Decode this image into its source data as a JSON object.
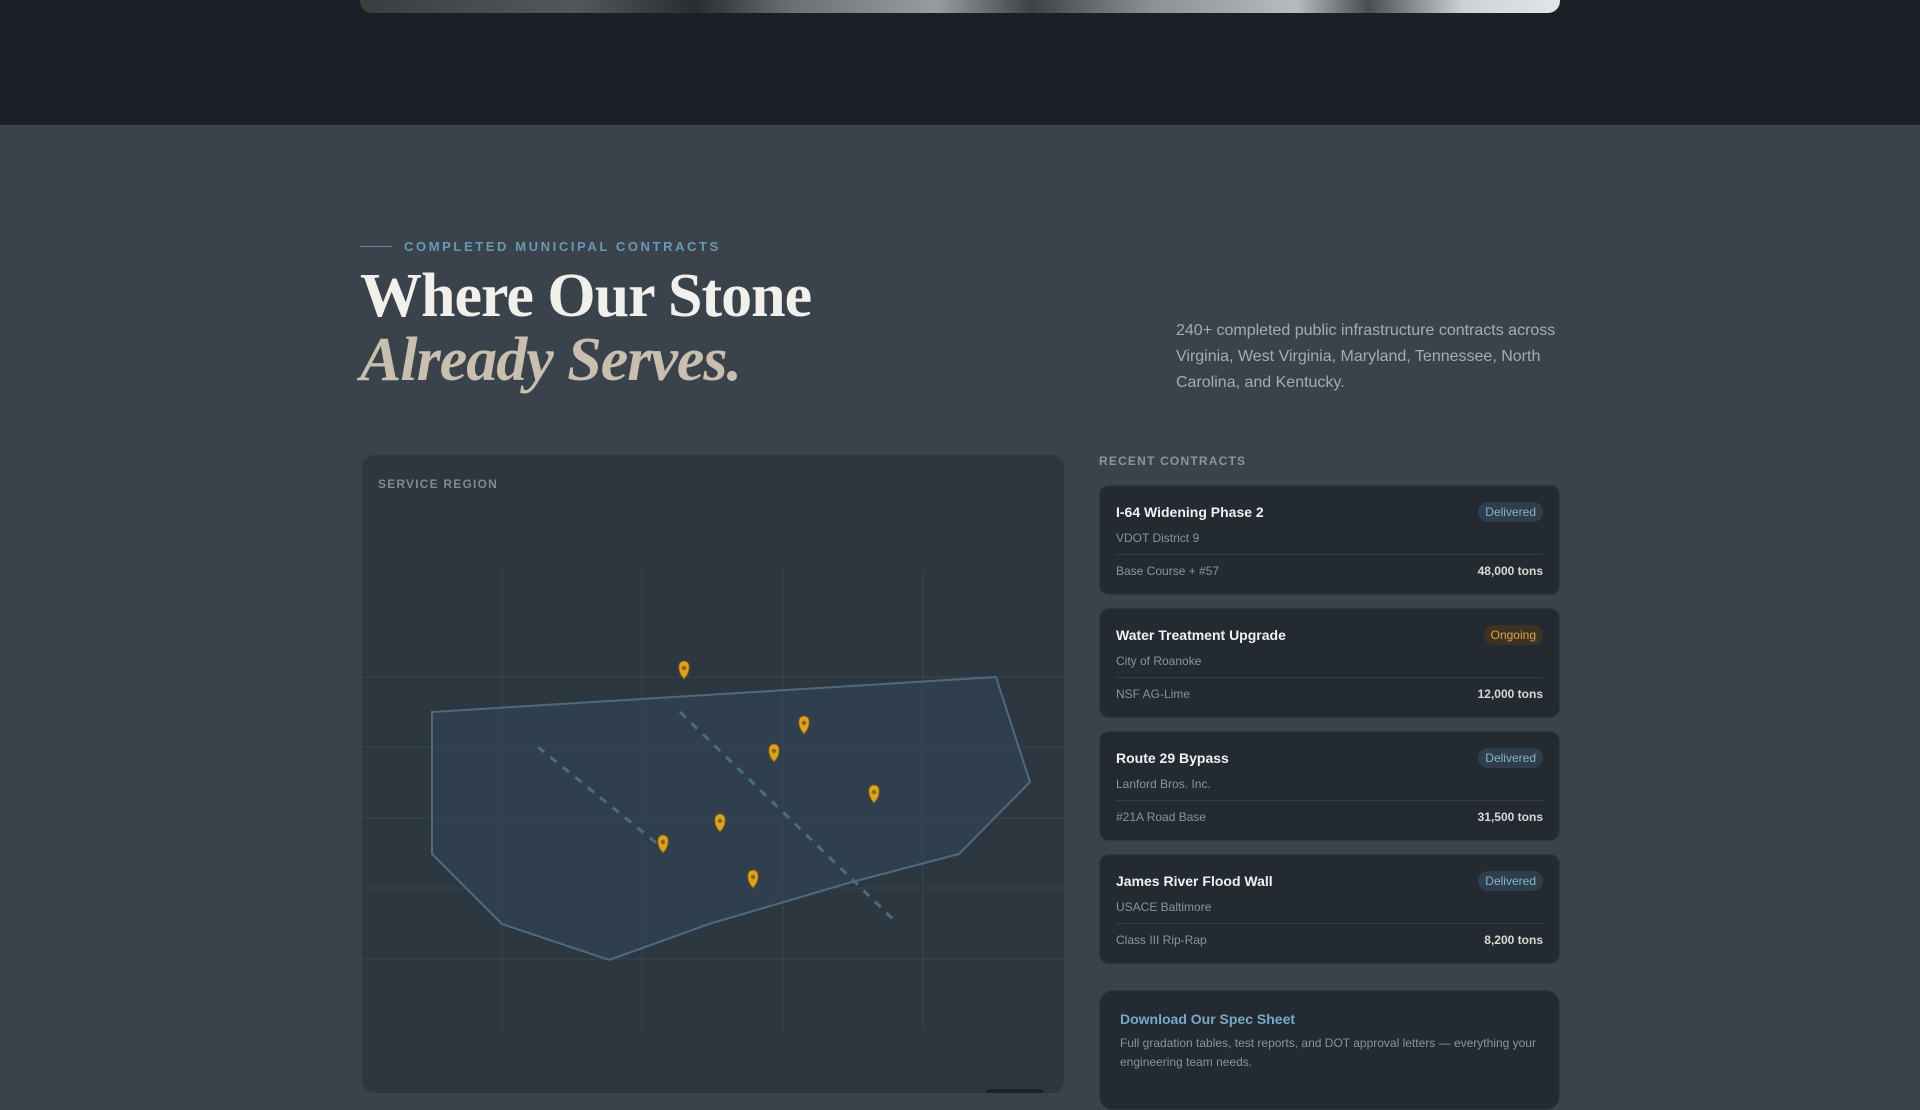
{
  "section": {
    "eyebrow": "COMPLETED MUNICIPAL CONTRACTS",
    "headline_line1": "Where Our Stone",
    "headline_line2": "Already Serves.",
    "lede": "240+ completed public infrastructure contracts across Virginia, West Virginia, Maryland, Tennessee, North Carolina, and Kentucky."
  },
  "map": {
    "label": "SERVICE REGION",
    "marker_color": "#e0a21a",
    "region_color": "#4d6b80",
    "marker_count": 7
  },
  "contracts": {
    "title": "RECENT CONTRACTS",
    "items": [
      {
        "name": "I-64 Widening Phase 2",
        "status": "Delivered",
        "client": "VDOT District 9",
        "material": "Base Course + #57",
        "tons": "48,000 tons"
      },
      {
        "name": "Water Treatment Upgrade",
        "status": "Ongoing",
        "client": "City of Roanoke",
        "material": "NSF AG-Lime",
        "tons": "12,000 tons"
      },
      {
        "name": "Route 29 Bypass",
        "status": "Delivered",
        "client": "Lanford Bros. Inc.",
        "material": "#21A Road Base",
        "tons": "31,500 tons"
      },
      {
        "name": "James River Flood Wall",
        "status": "Delivered",
        "client": "USACE Baltimore",
        "material": "Class III Rip-Rap",
        "tons": "8,200 tons"
      }
    ]
  },
  "spec": {
    "title": "Download Our Spec Sheet",
    "description": "Full gradation tables, test reports, and DOT approval letters — everything your engineering team needs."
  },
  "colors": {
    "accent": "#6a98b3",
    "delivered": "#86b4cc",
    "ongoing": "#d9a441",
    "background": "#3a434c"
  }
}
